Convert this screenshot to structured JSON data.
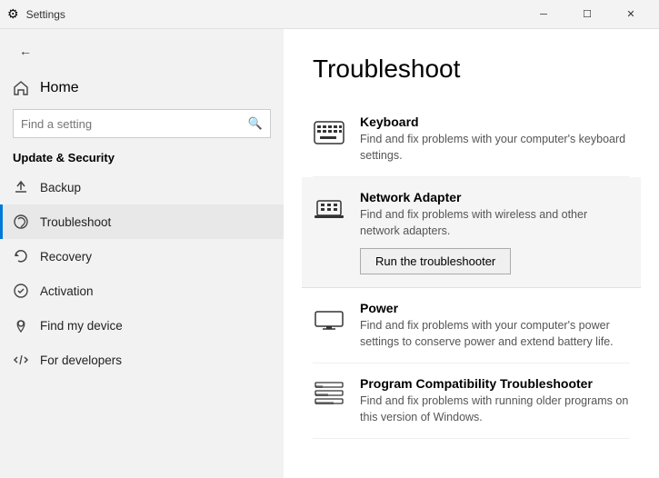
{
  "titlebar": {
    "title": "Settings",
    "minimize_label": "─",
    "maximize_label": "☐",
    "close_label": "✕"
  },
  "sidebar": {
    "back_label": "←",
    "home_label": "Home",
    "search_placeholder": "Find a setting",
    "section_title": "Update & Security",
    "items": [
      {
        "id": "backup",
        "label": "Backup",
        "icon": "backup-icon"
      },
      {
        "id": "troubleshoot",
        "label": "Troubleshoot",
        "icon": "troubleshoot-icon",
        "active": true
      },
      {
        "id": "recovery",
        "label": "Recovery",
        "icon": "recovery-icon"
      },
      {
        "id": "activation",
        "label": "Activation",
        "icon": "activation-icon"
      },
      {
        "id": "find-device",
        "label": "Find my device",
        "icon": "find-device-icon"
      },
      {
        "id": "developers",
        "label": "For developers",
        "icon": "developers-icon"
      }
    ]
  },
  "content": {
    "title": "Troubleshoot",
    "items": [
      {
        "id": "keyboard",
        "title": "Keyboard",
        "description": "Find and fix problems with your computer's keyboard settings.",
        "icon": "keyboard-icon",
        "highlighted": false
      },
      {
        "id": "network-adapter",
        "title": "Network Adapter",
        "description": "Find and fix problems with wireless and other network adapters.",
        "icon": "network-adapter-icon",
        "highlighted": true,
        "show_button": true,
        "button_label": "Run the troubleshooter"
      },
      {
        "id": "power",
        "title": "Power",
        "description": "Find and fix problems with your computer's power settings to conserve power and extend battery life.",
        "icon": "power-icon",
        "highlighted": false
      },
      {
        "id": "program-compat",
        "title": "Program Compatibility Troubleshooter",
        "description": "Find and fix problems with running older programs on this version of Windows.",
        "icon": "program-compat-icon",
        "highlighted": false
      }
    ]
  }
}
